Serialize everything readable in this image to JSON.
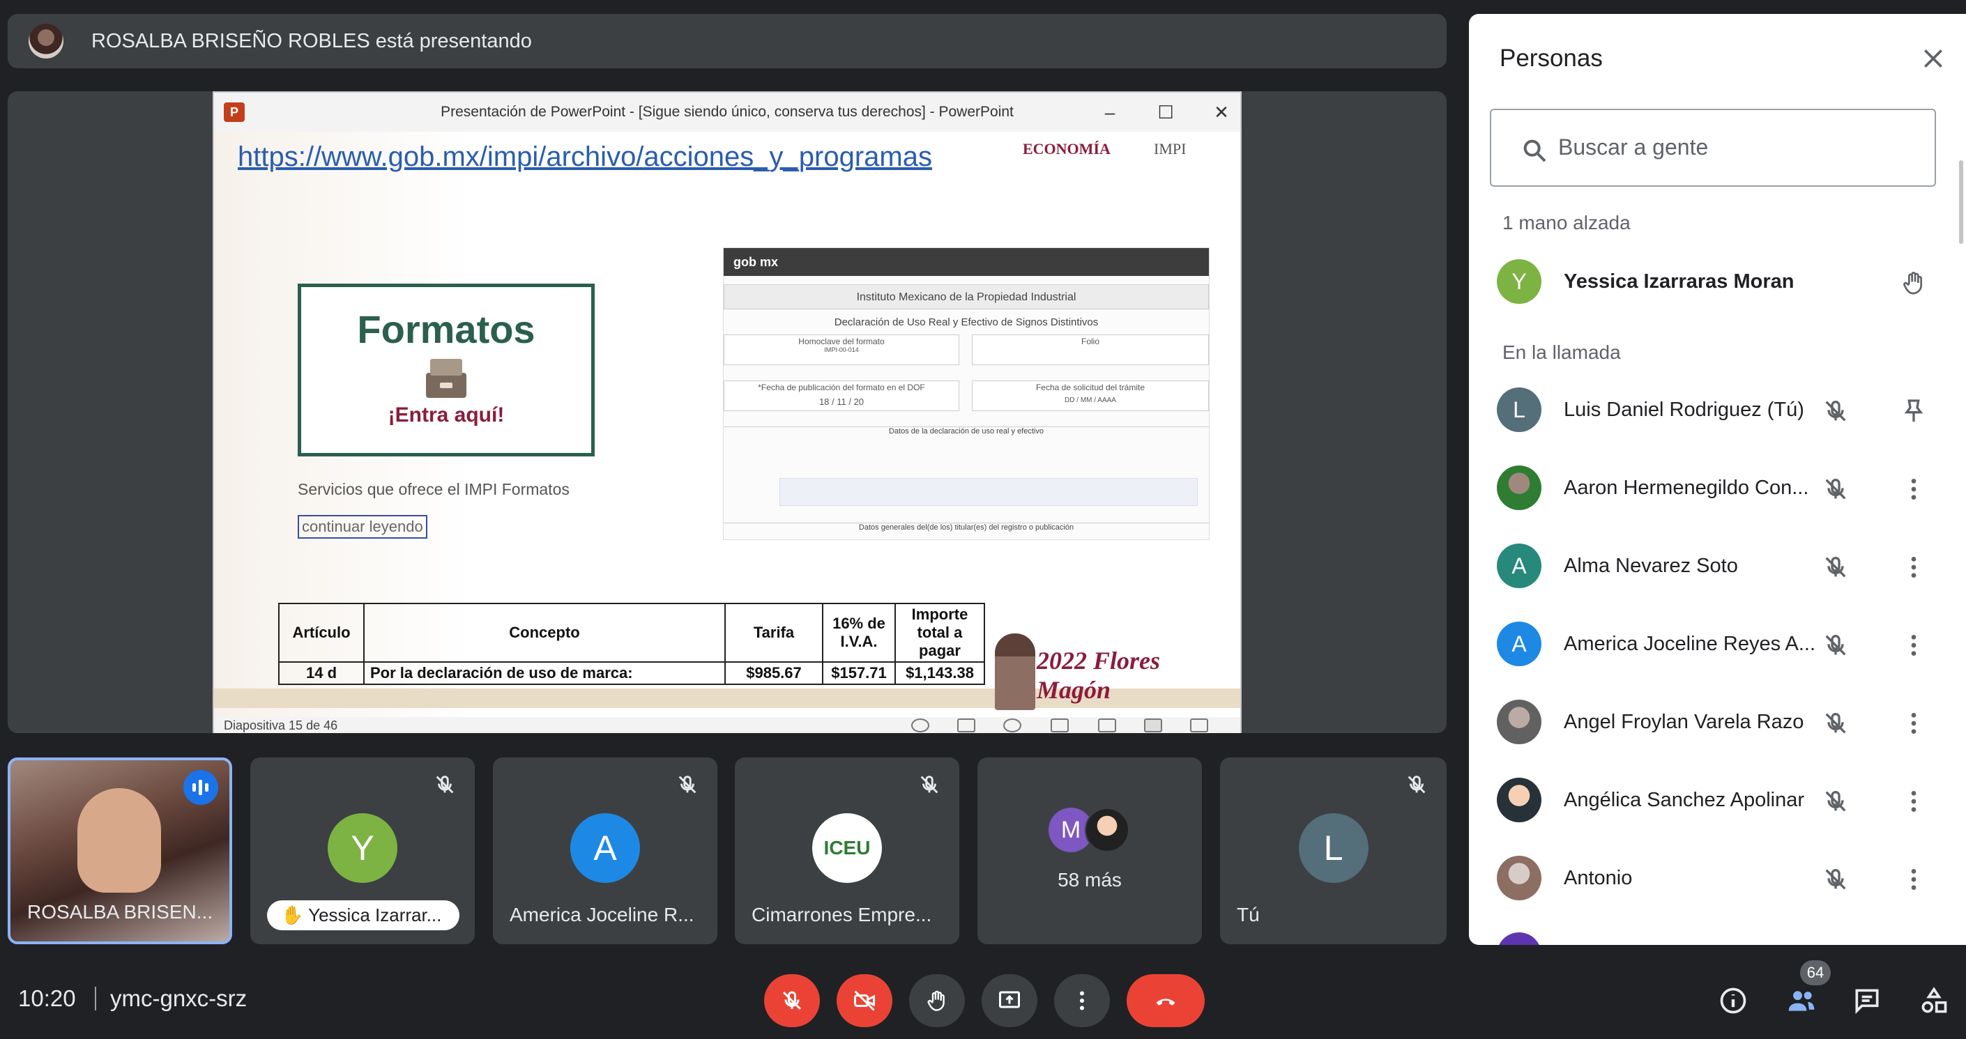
{
  "presenting_bar": {
    "text": "ROSALBA BRISEÑO ROBLES está presentando"
  },
  "ppt": {
    "window_title": "Presentación de PowerPoint - [Sigue siendo único, conserva tus derechos] - PowerPoint",
    "status": "Diapositiva 15 de 46",
    "slide": {
      "url": "https://www.gob.mx/impi/archivo/acciones_y_programas",
      "logo_economia": "ECONOMÍA",
      "logo_impi": "IMPI",
      "formatos_title": "Formatos",
      "formatos_cta": "¡Entra aquí!",
      "servicios": "Servicios que ofrece el IMPI Formatos",
      "continuar": "continuar leyendo",
      "form": {
        "head": "gob mx",
        "institute": "Instituto Mexicano de la Propiedad Industrial",
        "declaration": "Declaración de Uso Real y Efectivo de Signos Distintivos",
        "homoclave_label": "Homoclave del formato",
        "homoclave_value": "IMPI-00-014",
        "folio_label": "Folio",
        "fecha_pub_label": "*Fecha de publicación del formato en el DOF",
        "fecha_pub_value": "18 / 11 / 20",
        "fecha_sol_label": "Fecha de solicitud del trámite",
        "fecha_sol_value": "DD / MM / AAAA",
        "datos_label": "Datos de la declaración de uso real y efectivo",
        "generales_label": "Datos generales del(de los) titular(es) del registro o publicación"
      },
      "table": {
        "headers": [
          "Artículo",
          "Concepto",
          "Tarifa",
          "16% de I.V.A.",
          "Importe total a pagar"
        ],
        "row": [
          "14 d",
          "Por la declaración de uso de marca:",
          "$985.67",
          "$157.71",
          "$1,143.38"
        ]
      },
      "logo_2022": "2022 Flores Magón"
    }
  },
  "tiles": [
    {
      "name": "ROSALBA BRISEN...",
      "type": "video"
    },
    {
      "name": "Yessica Izarrar...",
      "initial": "Y",
      "color": "#7cb342",
      "hand": true
    },
    {
      "name": "America Joceline R...",
      "initial": "A",
      "color": "#1e88e5"
    },
    {
      "name": "Cimarrones Empre...",
      "logo": "ICEU"
    },
    {
      "more_label": "58 más",
      "initial": "M",
      "color": "#7e57c2"
    },
    {
      "name": "Tú",
      "initial": "L",
      "color": "#546e7a"
    }
  ],
  "panel": {
    "title": "Personas",
    "search_placeholder": "Buscar a gente",
    "raised_section": "1 mano alzada",
    "raised": {
      "name": "Yessica Izarraras Moran",
      "initial": "Y",
      "color": "#7cb342"
    },
    "call_section": "En la llamada",
    "people": [
      {
        "name": "Luis Daniel Rodriguez (Tú)",
        "initial": "L",
        "color": "#546e7a",
        "action": "pin"
      },
      {
        "name": "Aaron Hermenegildo Con...",
        "photo": true
      },
      {
        "name": "Alma Nevarez Soto",
        "initial": "A",
        "color": "#26897b"
      },
      {
        "name": "America Joceline Reyes A...",
        "initial": "A",
        "color": "#1e88e5"
      },
      {
        "name": "Angel Froylan Varela Razo",
        "photo": true
      },
      {
        "name": "Angélica Sanchez Apolinar",
        "photo": true
      },
      {
        "name": "Antonio",
        "photo": true
      }
    ]
  },
  "bottom": {
    "time": "10:20",
    "meeting_code": "ymc-gnxc-srz",
    "people_count": "64",
    "accent_red": "#ea4335"
  }
}
